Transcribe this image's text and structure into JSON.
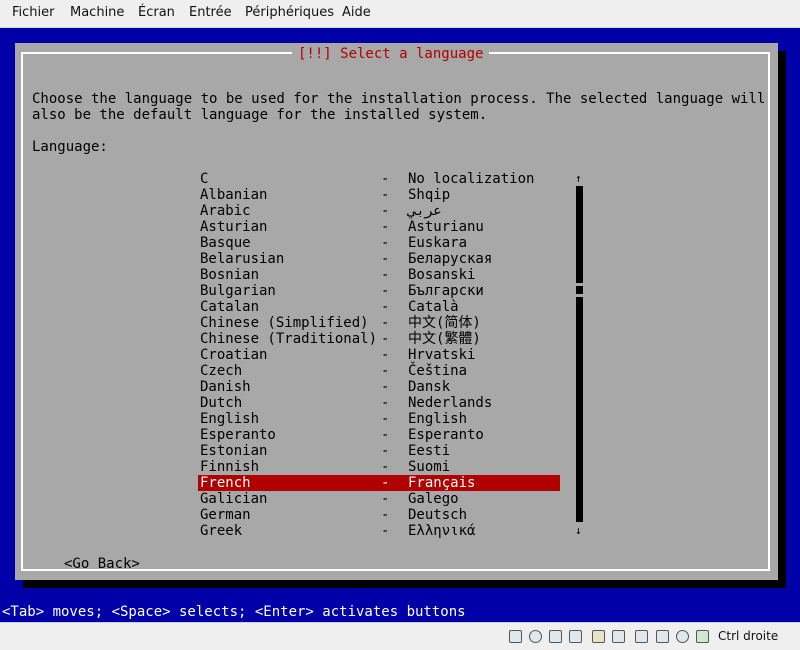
{
  "menubar": {
    "items": [
      "Fichier",
      "Machine",
      "Écran",
      "Entrée",
      "Périphériques",
      "Aide"
    ]
  },
  "dialog": {
    "title": "[!!] Select a language",
    "intro_line1": "Choose the language to be used for the installation process. The selected language will",
    "intro_line2": "also be the default language for the installed system.",
    "language_label": "Language:",
    "separator": "-",
    "languages": [
      {
        "name": "C",
        "native": "No localization"
      },
      {
        "name": "Albanian",
        "native": "Shqip"
      },
      {
        "name": "Arabic",
        "native": "عربي"
      },
      {
        "name": "Asturian",
        "native": "Asturianu"
      },
      {
        "name": "Basque",
        "native": "Euskara"
      },
      {
        "name": "Belarusian",
        "native": "Беларуская"
      },
      {
        "name": "Bosnian",
        "native": "Bosanski"
      },
      {
        "name": "Bulgarian",
        "native": "Български"
      },
      {
        "name": "Catalan",
        "native": "Català"
      },
      {
        "name": "Chinese (Simplified)",
        "native": "中文(简体)"
      },
      {
        "name": "Chinese (Traditional)",
        "native": "中文(繁體)"
      },
      {
        "name": "Croatian",
        "native": "Hrvatski"
      },
      {
        "name": "Czech",
        "native": "Čeština"
      },
      {
        "name": "Danish",
        "native": "Dansk"
      },
      {
        "name": "Dutch",
        "native": "Nederlands"
      },
      {
        "name": "English",
        "native": "English"
      },
      {
        "name": "Esperanto",
        "native": "Esperanto"
      },
      {
        "name": "Estonian",
        "native": "Eesti"
      },
      {
        "name": "Finnish",
        "native": "Suomi"
      },
      {
        "name": "French",
        "native": "Français"
      },
      {
        "name": "Galician",
        "native": "Galego"
      },
      {
        "name": "German",
        "native": "Deutsch"
      },
      {
        "name": "Greek",
        "native": "Ελληνικά"
      }
    ],
    "selected": "French",
    "go_back_label": "<Go Back>"
  },
  "scrollbar": {
    "up_arrow": "↑",
    "down_arrow": "↓"
  },
  "status_line": "<Tab> moves; <Space> selects; <Enter> activates buttons",
  "hostbar": {
    "icons": [
      "hard-disk-icon",
      "optical-drive-icon",
      "audio-icon",
      "pen-icon",
      "folder-icon",
      "shared-folder-icon",
      "display-icon",
      "recording-icon",
      "cpu-icon",
      "network-icon",
      "download-icon"
    ],
    "host_key_label": "Ctrl droite"
  },
  "colors": {
    "screen_bg": "#0000a8",
    "dialog_bg": "#a8a8a8",
    "title_red": "#b00000",
    "selection_bg": "#b00000"
  }
}
